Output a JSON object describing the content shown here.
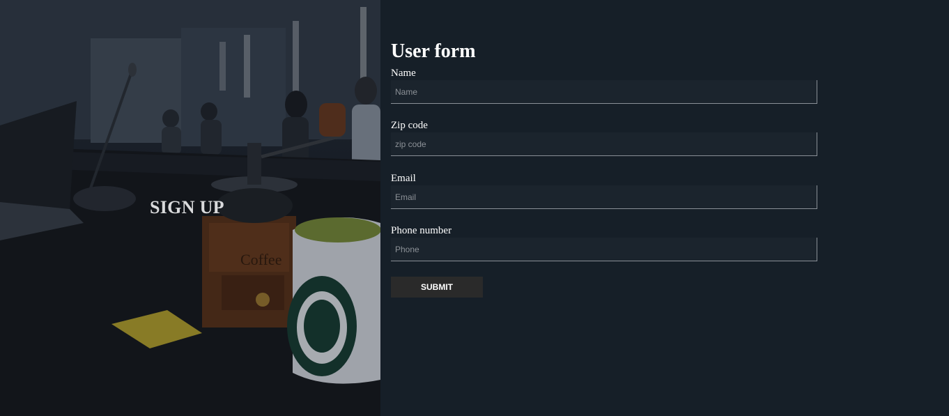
{
  "hero": {
    "title": "SIGN UP",
    "mug_print": "Coffee"
  },
  "form": {
    "title": "User form",
    "fields": [
      {
        "label": "Name",
        "placeholder": "Name",
        "value": ""
      },
      {
        "label": "Zip code",
        "placeholder": "zip code",
        "value": ""
      },
      {
        "label": "Email",
        "placeholder": "Email",
        "value": ""
      },
      {
        "label": "Phone number",
        "placeholder": "Phone",
        "value": ""
      }
    ],
    "submit_label": "SUBMIT"
  },
  "colors": {
    "panel_background": "#161f28",
    "input_background": "#1b242d",
    "button_background": "#2a2a2a",
    "text": "#ffffff"
  }
}
